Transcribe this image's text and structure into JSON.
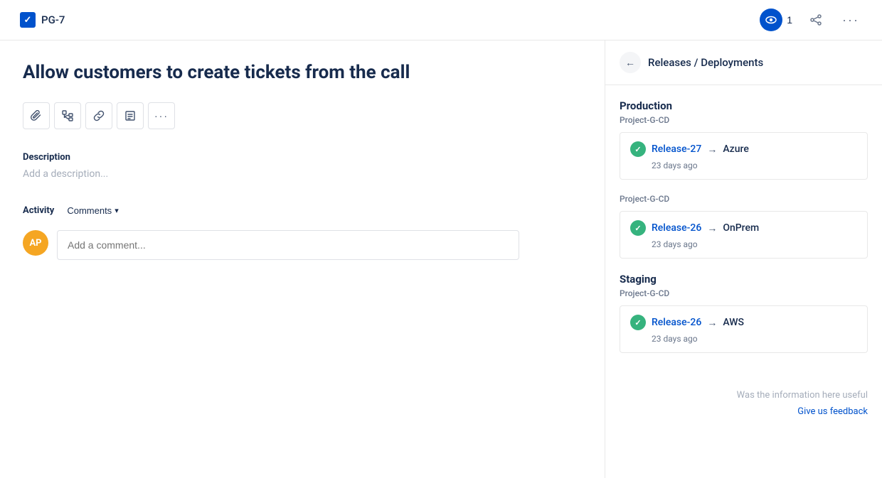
{
  "header": {
    "ticket_id": "PG-7",
    "watcher_count": "1",
    "share_label": "share",
    "more_label": "more"
  },
  "ticket": {
    "title": "Allow customers to create tickets from the call",
    "description_label": "Description",
    "description_placeholder": "Add a description..."
  },
  "toolbar": {
    "buttons": [
      {
        "icon": "📎",
        "name": "attachment",
        "label": "Attach"
      },
      {
        "icon": "⛓",
        "name": "child-issues",
        "label": "Child issues"
      },
      {
        "icon": "🔗",
        "name": "link",
        "label": "Link"
      },
      {
        "icon": "📋",
        "name": "template",
        "label": "Template"
      },
      {
        "icon": "···",
        "name": "more-actions",
        "label": "More"
      }
    ]
  },
  "activity": {
    "label": "Activity",
    "filter_label": "Comments",
    "comment_placeholder": "Add a comment...",
    "avatar_initials": "AP"
  },
  "releases_panel": {
    "back_label": "←",
    "title": "Releases / Deployments",
    "environments": [
      {
        "name": "Production",
        "project": "Project-G-CD",
        "releases": [
          {
            "release_name": "Release-27",
            "arrow": "→",
            "target": "Azure",
            "time": "23 days ago"
          }
        ]
      },
      {
        "name": "",
        "project": "Project-G-CD",
        "releases": [
          {
            "release_name": "Release-26",
            "arrow": "→",
            "target": "OnPrem",
            "time": "23 days ago"
          }
        ]
      },
      {
        "name": "Staging",
        "project": "Project-G-CD",
        "releases": [
          {
            "release_name": "Release-26",
            "arrow": "→",
            "target": "AWS",
            "time": "23 days ago"
          }
        ]
      }
    ],
    "feedback_text": "Was the information here useful",
    "feedback_link": "Give us feedback"
  }
}
